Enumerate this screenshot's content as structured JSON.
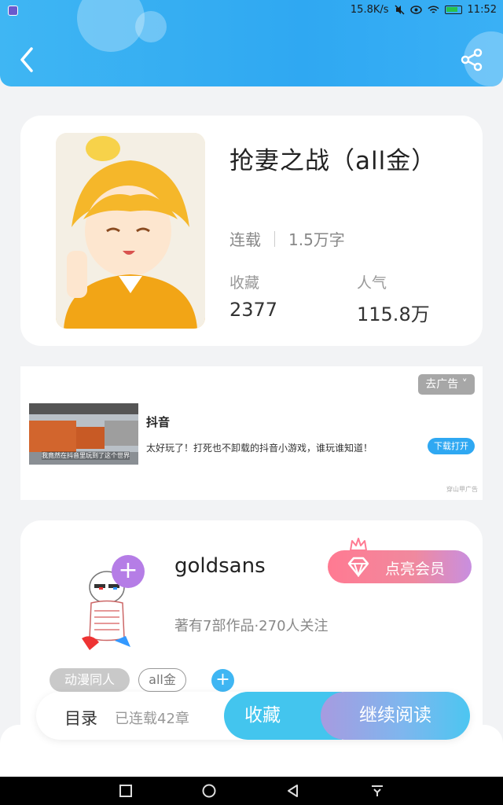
{
  "status_bar": {
    "network_speed": "15.8K/s",
    "time": "11:52"
  },
  "book": {
    "title": "抢妻之战（all金）",
    "status": "连载",
    "word_count": "1.5万字",
    "favorites_label": "收藏",
    "favorites_value": "2377",
    "popularity_label": "人气",
    "popularity_value": "115.8万"
  },
  "ad": {
    "close_label": "去广告",
    "app_name": "抖音",
    "description": "太好玩了！打死也不卸载的抖音小游戏，谁玩谁知道！",
    "download_label": "下载打开",
    "thumb_caption": "我竟然在抖音里玩到了这个世界",
    "source": "穿山甲广告"
  },
  "author": {
    "name": "goldsans",
    "vip_label": "点亮会员",
    "meta": "著有7部作品·270人关注",
    "tags": [
      "动漫同人",
      "all金"
    ]
  },
  "bottom_bar": {
    "toc_label": "目录",
    "chapters": "已连载42章",
    "collect_label": "收藏",
    "read_label": "继续阅读"
  },
  "colors": {
    "brand_blue": "#2fa8f2",
    "vip_pink": "#ff7a92",
    "plus_purple": "#b57de6"
  }
}
